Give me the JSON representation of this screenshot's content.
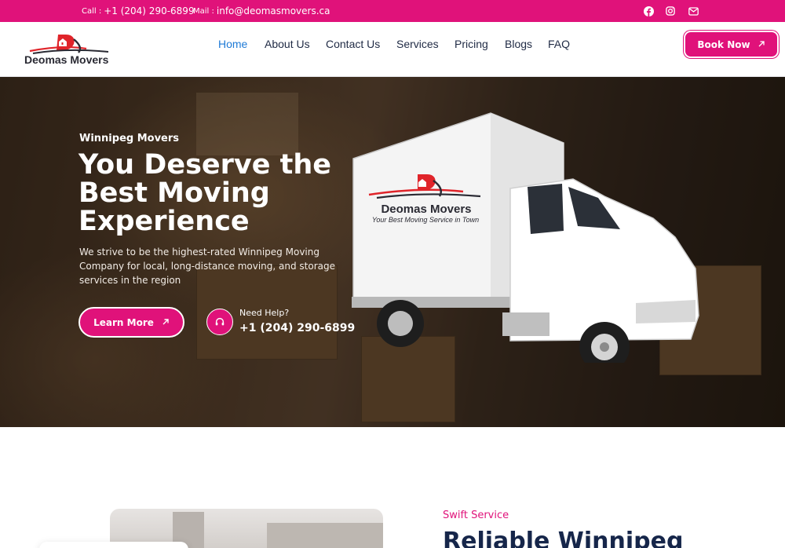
{
  "topbar": {
    "phone_label": "Call :",
    "phone": "+1 (204) 290-6899",
    "email_label": "Mail :",
    "email": "info@deomasmovers.ca",
    "social_icons": [
      "facebook-icon",
      "instagram-icon",
      "envelope-icon"
    ]
  },
  "header": {
    "logo_text": "Deomas Movers",
    "nav": [
      "Home",
      "About Us",
      "Contact Us",
      "Services",
      "Pricing",
      "Blogs",
      "FAQ"
    ],
    "active_nav": "Home",
    "book_label": "Book Now"
  },
  "hero": {
    "eyebrow": "Winnipeg Movers",
    "title": "You Deserve the Best Moving Experience",
    "description": "We strive to be the highest-rated Winnipeg Moving Company for local, long-distance moving, and storage services in the region",
    "cta_label": "Learn More",
    "help_label": "Need Help?",
    "help_phone": "+1 (204) 290-6899",
    "truck_brand": "Deomas Movers",
    "truck_tagline": "Your Best Moving  Service in Town"
  },
  "section": {
    "eyebrow": "Swift Service",
    "title": "Reliable Winnipeg"
  },
  "colors": {
    "accent": "#e0127a",
    "nav_active": "#1e7ad6",
    "heading_dark": "#16264a"
  }
}
